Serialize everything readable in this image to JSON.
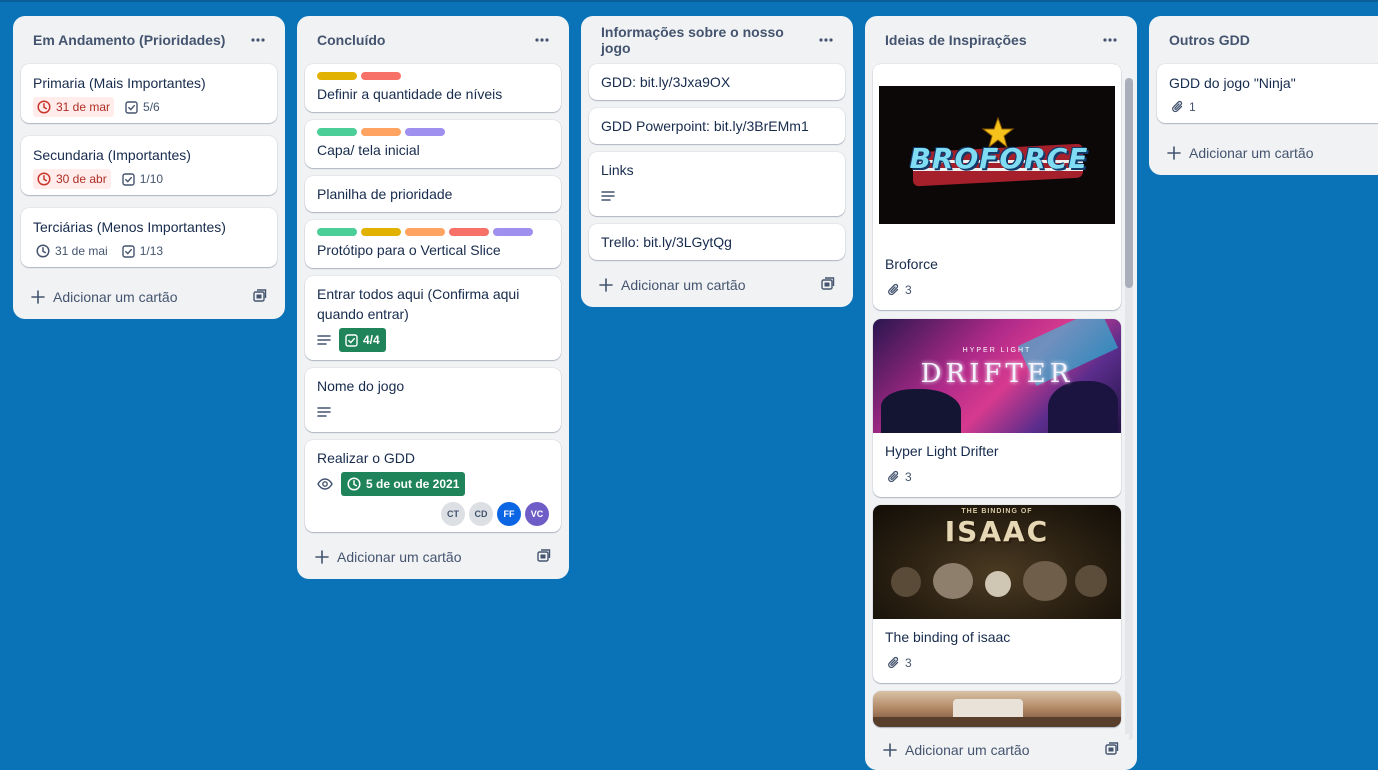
{
  "colors": {
    "board_bg": "#0a73b8",
    "label_yellow": "#e2b203",
    "label_red": "#f87168",
    "label_green": "#4bce97",
    "label_orange": "#fea362",
    "label_purple": "#9f8fef",
    "due_overdue_bg": "#ffeceb",
    "due_complete_bg": "#1f845a"
  },
  "common": {
    "add_card_label": "Adicionar um cartão"
  },
  "lists": [
    {
      "title": "Em Andamento (Prioridades)",
      "cards": [
        {
          "title": "Primaria (Mais Importantes)",
          "due": "31 de mar",
          "checklist": "5/6"
        },
        {
          "title": "Secundaria (Importantes)",
          "due": "30 de abr",
          "checklist": "1/10"
        },
        {
          "title": "Terciárias (Menos Importantes)",
          "due": "31 de mai",
          "checklist": "1/13"
        }
      ]
    },
    {
      "title": "Concluído",
      "cards": [
        {
          "title": "Definir a quantidade de níveis",
          "labels": [
            "yellow",
            "red"
          ]
        },
        {
          "title": "Capa/ tela inicial",
          "labels": [
            "green",
            "orange",
            "purple"
          ]
        },
        {
          "title": "Planilha de prioridade"
        },
        {
          "title": "Protótipo para o Vertical Slice",
          "labels": [
            "green",
            "yellow",
            "orange",
            "red",
            "purple"
          ]
        },
        {
          "title": "Entrar todos aqui (Confirma aqui quando entrar)",
          "checklist": "4/4",
          "has_description": true
        },
        {
          "title": "Nome do jogo",
          "has_description": true
        },
        {
          "title": "Realizar o GDD",
          "due": "5 de out de 2021",
          "watching": true,
          "members": [
            "CT",
            "CD",
            "FF",
            "VC"
          ]
        }
      ]
    },
    {
      "title": "Informações sobre o nosso jogo",
      "cards": [
        {
          "title": "GDD: bit.ly/3Jxa9OX"
        },
        {
          "title": "GDD Powerpoint: bit.ly/3BrEMm1"
        },
        {
          "title": "Links",
          "has_description": true
        },
        {
          "title": "Trello: bit.ly/3LGytQg"
        }
      ]
    },
    {
      "title": "Ideias de Inspirações",
      "cards": [
        {
          "title": "Broforce",
          "attachments": "3",
          "cover_text": "BROFORCE"
        },
        {
          "title": "Hyper Light Drifter",
          "attachments": "3",
          "cover_text_small": "HYPER LIGHT",
          "cover_text": "DRIFTER"
        },
        {
          "title": "The binding of isaac",
          "attachments": "3",
          "cover_text_small": "THE BINDING OF",
          "cover_text": "ISAAC"
        }
      ]
    },
    {
      "title": "Outros GDD",
      "cards": [
        {
          "title": "GDD do jogo \"Ninja\"",
          "attachments": "1"
        }
      ]
    }
  ]
}
